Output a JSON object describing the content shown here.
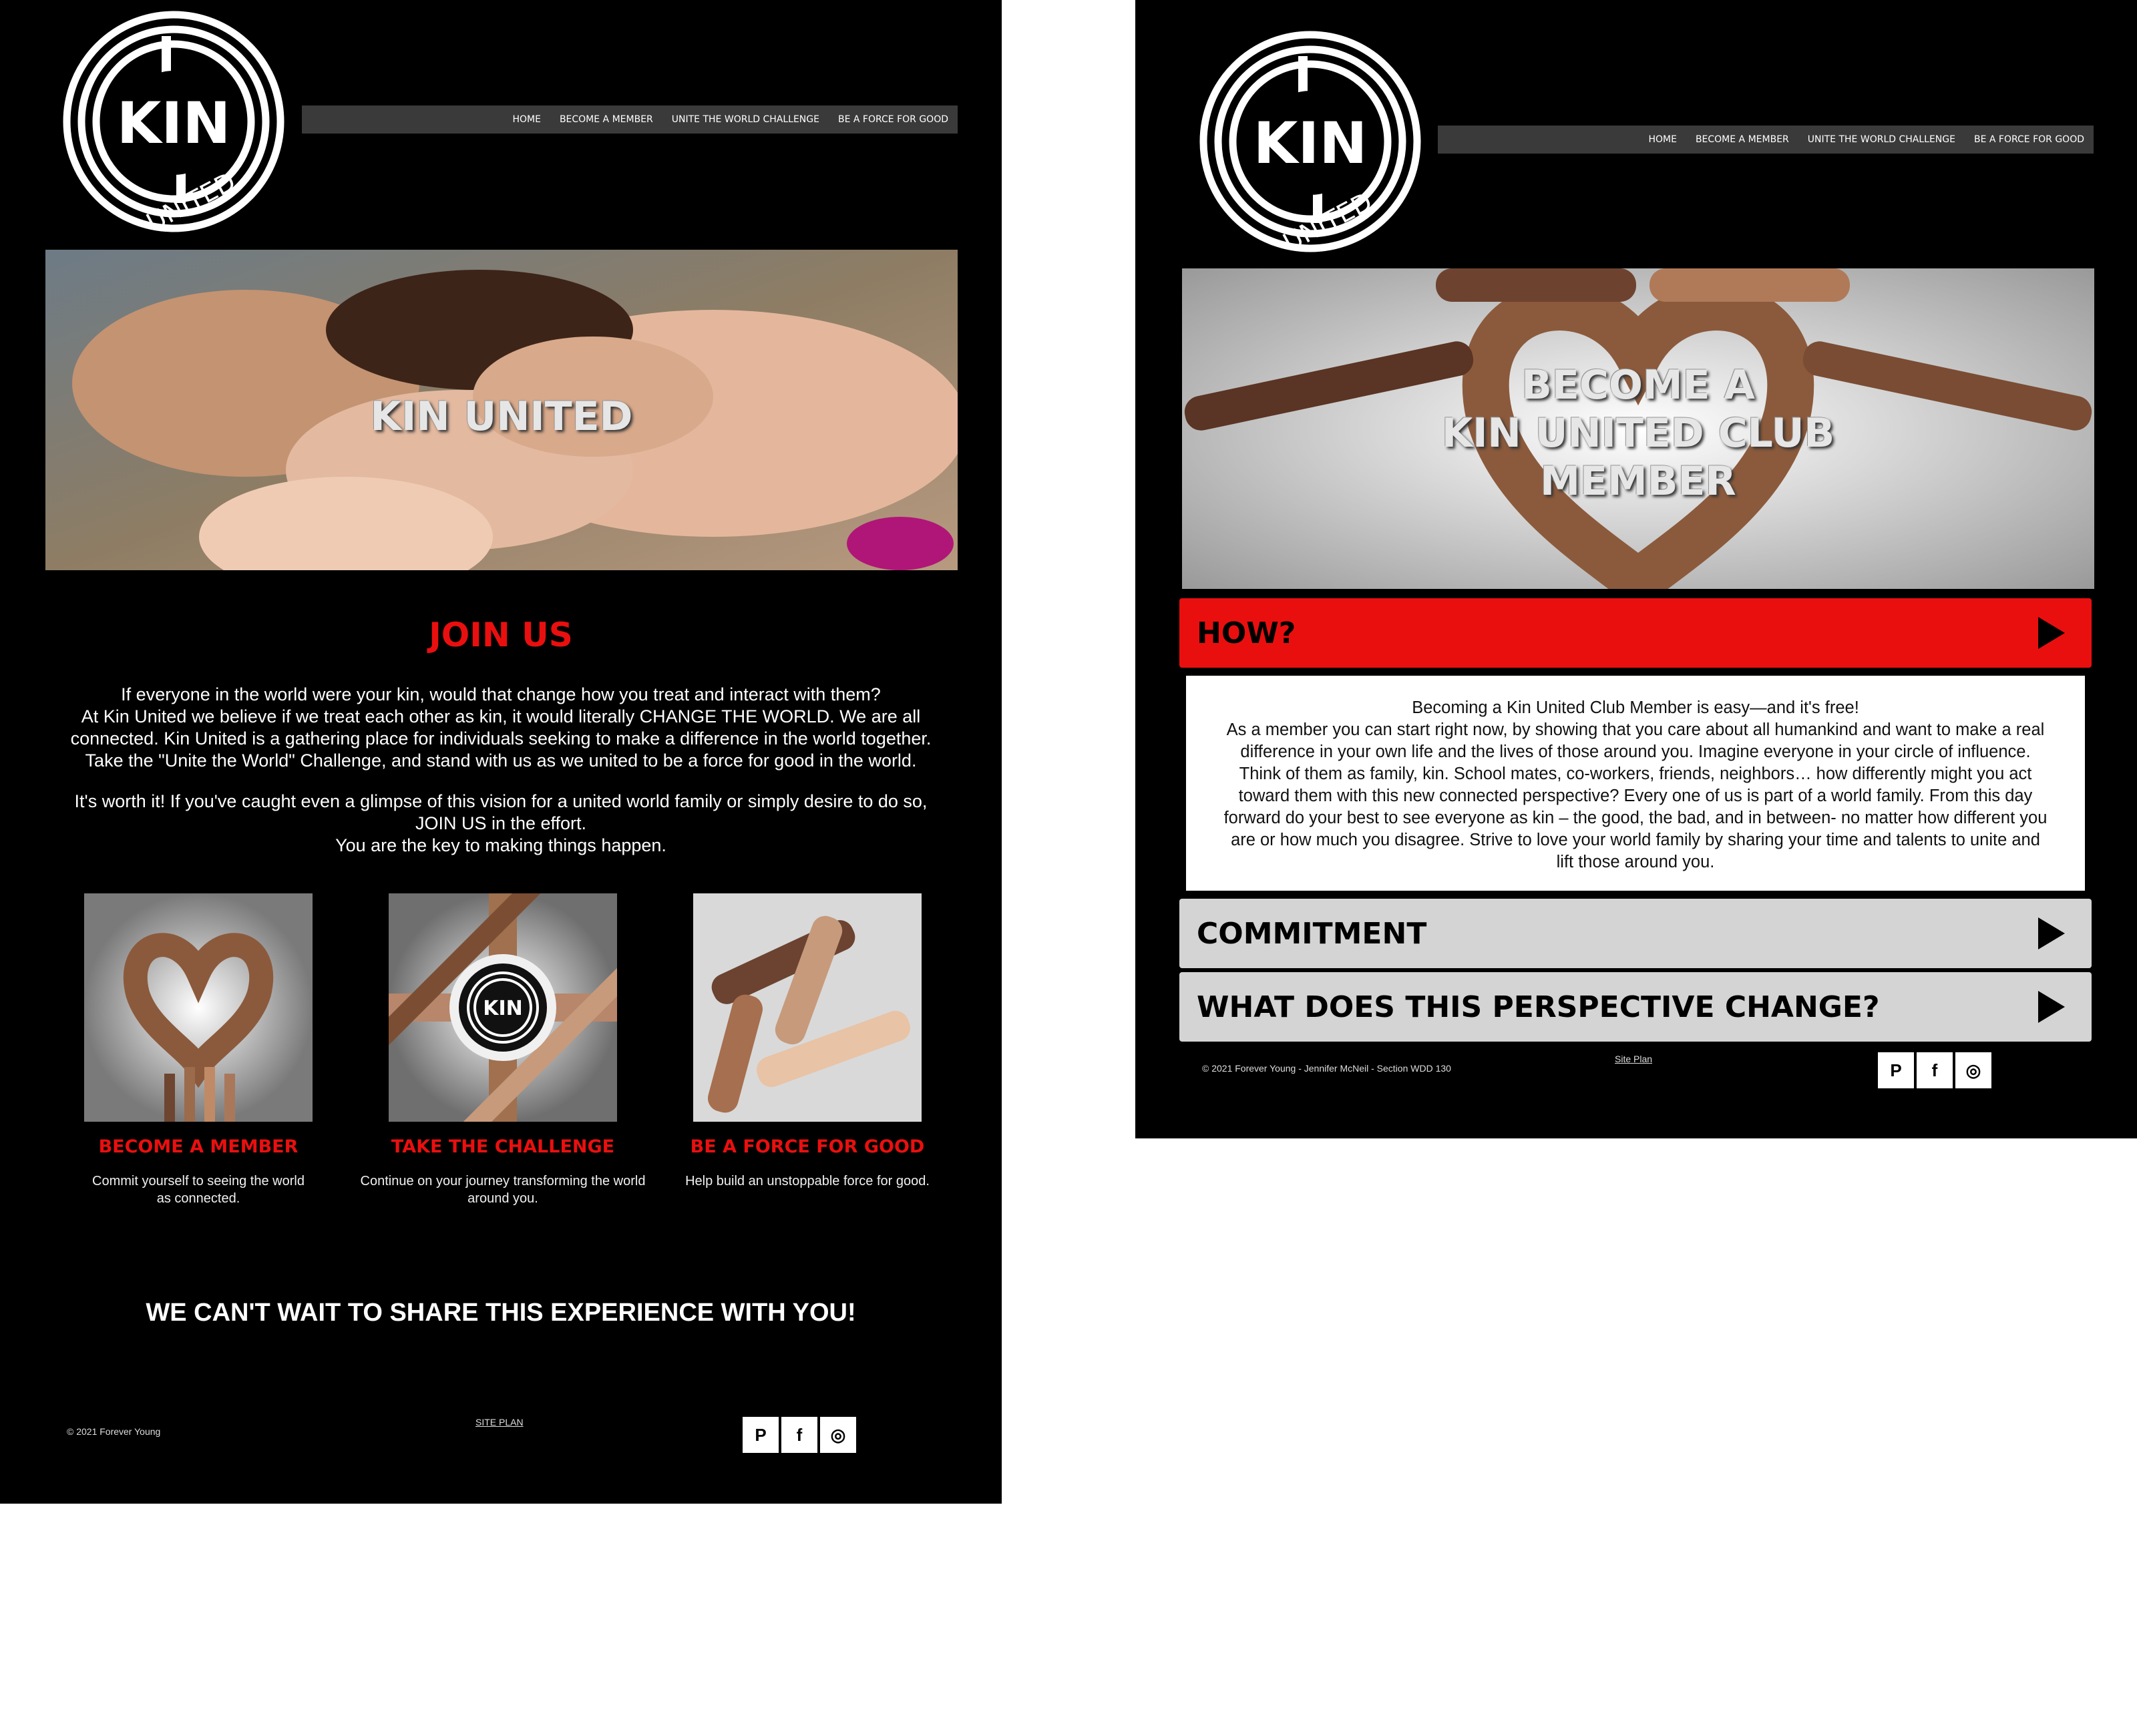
{
  "left_page": {
    "logo": {
      "word1": "KIN",
      "word2": "UNITED"
    },
    "nav": [
      "HOME",
      "BECOME A MEMBER",
      "UNITE THE WORLD CHALLENGE",
      "BE A FORCE FOR GOOD"
    ],
    "hero_title": "KIN UNITED",
    "join_heading": "JOIN US",
    "paragraph1": [
      "If everyone in the world were your kin, would that change how you treat and interact with them?",
      "At Kin United we believe if we treat each other as kin, it would literally CHANGE THE WORLD. We are all",
      "connected. Kin United is a gathering place for individuals seeking to make a difference in the world together.",
      "Take the \"Unite the World\" Challenge, and stand with us as we united to be a force for good in the world."
    ],
    "paragraph2": [
      "It's worth it! If you've caught even a glimpse of this vision for a united world family or simply desire to do so,",
      "JOIN US in the effort.",
      "You are the key to making things happen."
    ],
    "features": [
      {
        "title": "BECOME A MEMBER",
        "desc": "Commit yourself to seeing the world as connected."
      },
      {
        "title": "TAKE THE CHALLENGE",
        "desc": "Continue on your journey transforming the world around you."
      },
      {
        "title": "BE A FORCE FOR GOOD",
        "desc": "Help build an unstoppable force for good."
      }
    ],
    "cta": "WE CAN'T WAIT TO SHARE THIS EXPERIENCE WITH YOU!",
    "footer": {
      "copyright": "© 2021 Forever Young",
      "siteplan": "SITE PLAN"
    }
  },
  "right_page": {
    "logo": {
      "word1": "KIN",
      "word2": "UNITED"
    },
    "nav": [
      "HOME",
      "BECOME A MEMBER",
      "UNITE THE WORLD CHALLENGE",
      "BE A FORCE FOR GOOD"
    ],
    "hero_lines": [
      "BECOME A",
      "KIN UNITED CLUB",
      "MEMBER"
    ],
    "accordion": [
      {
        "title": "HOW?",
        "expanded": true,
        "body_lines": [
          "Becoming a Kin United Club Member is easy—and it's free!",
          "As a member you can start right now, by showing that you care about all humankind and want to make a real",
          "difference in your own life and the lives of those around you. Imagine everyone in your circle of influence.",
          "Think of them as family, kin. School mates, co-workers, friends, neighbors… how differently might you act",
          "toward them with this new connected perspective? Every one of us is part of a world family. From this day",
          "forward do your best to see everyone as kin – the good, the bad, and in between- no matter how different you",
          "are or how much you disagree. Strive to love your world family by sharing your time and talents to unite and",
          "lift those around you."
        ]
      },
      {
        "title": "COMMITMENT",
        "expanded": false
      },
      {
        "title": "WHAT DOES THIS PERSPECTIVE CHANGE?",
        "expanded": false
      }
    ],
    "footer": {
      "copyright": "© 2021 Forever Young - Jennifer McNeil - Section WDD 130",
      "siteplan": "Site Plan"
    }
  },
  "social_icons": [
    {
      "name": "pinterest-icon",
      "glyph": "P"
    },
    {
      "name": "facebook-icon",
      "glyph": "f"
    },
    {
      "name": "instagram-icon",
      "glyph": "◎"
    }
  ],
  "colors": {
    "accent_red": "#ea0f0f",
    "nav_bg": "#3a3a3a",
    "page_bg": "#000000",
    "accordion_gray": "#d4d4d4"
  }
}
